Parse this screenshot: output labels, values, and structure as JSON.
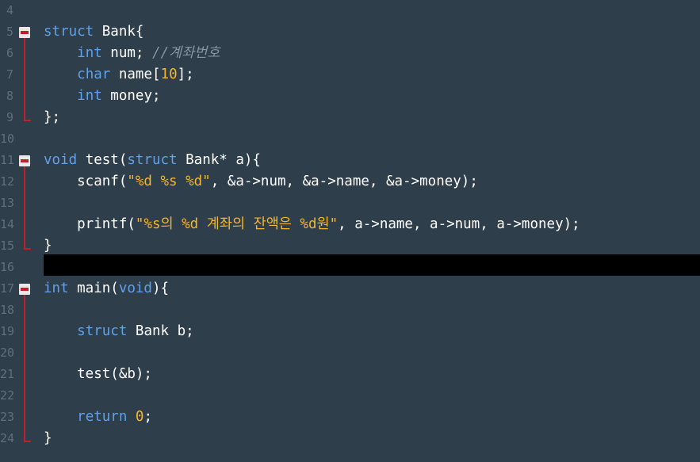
{
  "editor": {
    "line_numbers": [
      "4",
      "5",
      "6",
      "7",
      "8",
      "9",
      "10",
      "11",
      "12",
      "13",
      "14",
      "15",
      "16",
      "17",
      "18",
      "19",
      "20",
      "21",
      "22",
      "23",
      "24"
    ],
    "lines": {
      "l4": [],
      "l5": [
        [
          "kw",
          "struct"
        ],
        [
          "id",
          " Bank{"
        ]
      ],
      "l6": [
        [
          "id",
          "    "
        ],
        [
          "kw",
          "int"
        ],
        [
          "id",
          " num; "
        ],
        [
          "cm",
          "//계좌번호"
        ]
      ],
      "l7": [
        [
          "id",
          "    "
        ],
        [
          "kw",
          "char"
        ],
        [
          "id",
          " name["
        ],
        [
          "num",
          "10"
        ],
        [
          "id",
          "];"
        ]
      ],
      "l8": [
        [
          "id",
          "    "
        ],
        [
          "kw",
          "int"
        ],
        [
          "id",
          " money;"
        ]
      ],
      "l9": [
        [
          "id",
          "};"
        ]
      ],
      "l10": [],
      "l11": [
        [
          "kw",
          "void"
        ],
        [
          "id",
          " test("
        ],
        [
          "kw",
          "struct"
        ],
        [
          "id",
          " Bank* a){"
        ]
      ],
      "l12": [
        [
          "id",
          "    scanf("
        ],
        [
          "str",
          "\"%d %s %d\""
        ],
        [
          "id",
          ", &a->num, &a->name, &a->money);"
        ]
      ],
      "l13": [],
      "l14": [
        [
          "id",
          "    printf("
        ],
        [
          "str",
          "\"%s의 %d 계좌의 잔액은 %d원\""
        ],
        [
          "id",
          ", a->name, a->num, a->money);"
        ]
      ],
      "l15": [
        [
          "id",
          "}"
        ]
      ],
      "l16": [],
      "l17": [
        [
          "kw",
          "int"
        ],
        [
          "id",
          " main("
        ],
        [
          "kw",
          "void"
        ],
        [
          "id",
          "){"
        ]
      ],
      "l18": [],
      "l19": [
        [
          "id",
          "    "
        ],
        [
          "kw",
          "struct"
        ],
        [
          "id",
          " Bank b;"
        ]
      ],
      "l20": [],
      "l21": [
        [
          "id",
          "    test(&b);"
        ]
      ],
      "l22": [],
      "l23": [
        [
          "id",
          "    "
        ],
        [
          "kw",
          "return"
        ],
        [
          "id",
          " "
        ],
        [
          "num",
          "0"
        ],
        [
          "id",
          ";"
        ]
      ],
      "l24": [
        [
          "id",
          "}"
        ]
      ]
    },
    "colors": {
      "background": "#2f3e4b",
      "keyword": "#5fa1ea",
      "string": "#f7b52a",
      "comment": "#8794a5",
      "fold_marker": "#c0202a",
      "current_line": "#000000"
    }
  }
}
